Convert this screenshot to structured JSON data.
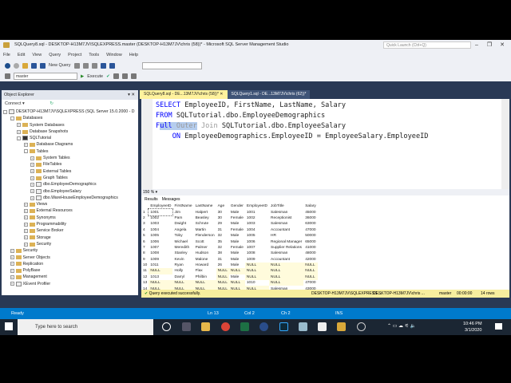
{
  "window": {
    "title": "SQLQuery8.sql - DESKTOP-H13M7JV\\SQLEXPRESS.master (DESKTOP-H13M7JV\\chris (58))* - Microsoft SQL Server Management Studio",
    "quick_launch_placeholder": "Quick Launch (Ctrl+Q)"
  },
  "menu": [
    "File",
    "Edit",
    "View",
    "Query",
    "Project",
    "Tools",
    "Window",
    "Help"
  ],
  "toolbar": {
    "new_query": "New Query",
    "database": "master",
    "execute": "Execute"
  },
  "object_explorer": {
    "title": "Object Explorer",
    "connect": "Connect",
    "nodes": [
      {
        "label": "DESKTOP-H13M7JV\\SQLEXPRESS (SQL Server 15.0.2000 - D",
        "level": 0,
        "type": "server",
        "exp": "-"
      },
      {
        "label": "Databases",
        "level": 1,
        "type": "folder",
        "exp": "-"
      },
      {
        "label": "System Databases",
        "level": 2,
        "type": "folder",
        "exp": "+"
      },
      {
        "label": "Database Snapshots",
        "level": 2,
        "type": "folder",
        "exp": "+"
      },
      {
        "label": "SQLTutorial",
        "level": 2,
        "type": "db",
        "exp": "-"
      },
      {
        "label": "Database Diagrams",
        "level": 3,
        "type": "folder",
        "exp": "+"
      },
      {
        "label": "Tables",
        "level": 3,
        "type": "folder",
        "exp": "-"
      },
      {
        "label": "System Tables",
        "level": 4,
        "type": "folder",
        "exp": "+"
      },
      {
        "label": "FileTables",
        "level": 4,
        "type": "folder",
        "exp": "+"
      },
      {
        "label": "External Tables",
        "level": 4,
        "type": "folder",
        "exp": "+"
      },
      {
        "label": "Graph Tables",
        "level": 4,
        "type": "folder",
        "exp": "+"
      },
      {
        "label": "dbo.EmployeeDemographics",
        "level": 4,
        "type": "table",
        "exp": "+"
      },
      {
        "label": "dbo.EmployeeSalary",
        "level": 4,
        "type": "table",
        "exp": "+"
      },
      {
        "label": "dbo.WareHouseEmployeeDemographics",
        "level": 4,
        "type": "table",
        "exp": "+"
      },
      {
        "label": "Views",
        "level": 3,
        "type": "folder",
        "exp": "+"
      },
      {
        "label": "External Resources",
        "level": 3,
        "type": "folder",
        "exp": "+"
      },
      {
        "label": "Synonyms",
        "level": 3,
        "type": "folder",
        "exp": "+"
      },
      {
        "label": "Programmability",
        "level": 3,
        "type": "folder",
        "exp": "+"
      },
      {
        "label": "Service Broker",
        "level": 3,
        "type": "folder",
        "exp": "+"
      },
      {
        "label": "Storage",
        "level": 3,
        "type": "folder",
        "exp": "+"
      },
      {
        "label": "Security",
        "level": 3,
        "type": "folder",
        "exp": "+"
      },
      {
        "label": "Security",
        "level": 1,
        "type": "folder",
        "exp": "+"
      },
      {
        "label": "Server Objects",
        "level": 1,
        "type": "folder",
        "exp": "+"
      },
      {
        "label": "Replication",
        "level": 1,
        "type": "folder",
        "exp": "+"
      },
      {
        "label": "PolyBase",
        "level": 1,
        "type": "folder",
        "exp": "+"
      },
      {
        "label": "Management",
        "level": 1,
        "type": "folder",
        "exp": "+"
      },
      {
        "label": "XEvent Profiler",
        "level": 1,
        "type": "xevent",
        "exp": "+"
      }
    ]
  },
  "tabs": [
    {
      "label": "SQLQuery8.sql - DE...13M7JV\\chris (58))*",
      "active": true
    },
    {
      "label": "SQLQuery1.sql - DE...13M7JV\\chris (62))*",
      "active": false
    }
  ],
  "editor": {
    "lines": [
      [
        {
          "t": "SELECT",
          "c": "kw"
        },
        {
          "t": " EmployeeID, FirstName, LastName, Salary"
        }
      ],
      [
        {
          "t": "FROM",
          "c": "kw"
        },
        {
          "t": " SQLTutorial.dbo.EmployeeDemographics"
        }
      ],
      [
        {
          "t": "F",
          "c": "kw"
        },
        {
          "t": "ull",
          "c": "kw sel"
        },
        {
          "t": " Outer",
          "c": "gr sel"
        },
        {
          "t": " Join",
          "c": "gr"
        },
        {
          "t": " SQLTutorial.dbo.EmployeeSalary"
        }
      ],
      [
        {
          "t": "    ON",
          "c": "kw"
        },
        {
          "t": " EmployeeDemographics.EmployeeID = EmployeeSalary.EmployeeID"
        }
      ]
    ]
  },
  "zoom": "150 %",
  "results": {
    "tab_results": "Results",
    "tab_messages": "Messages",
    "columns": [
      "EmployeeID",
      "FirstName",
      "LastName",
      "Age",
      "Gender",
      "EmployeeID",
      "JobTitle",
      "Salary"
    ],
    "rows": [
      [
        "1001",
        "Jim",
        "Halpert",
        "30",
        "Male",
        "1001",
        "Salesman",
        "45000"
      ],
      [
        "1002",
        "Pam",
        "Beasley",
        "30",
        "Female",
        "1002",
        "Receptionist",
        "36000"
      ],
      [
        "1003",
        "Dwight",
        "Schrute",
        "29",
        "Male",
        "1003",
        "Salesman",
        "63000"
      ],
      [
        "1004",
        "Angela",
        "Martin",
        "31",
        "Female",
        "1004",
        "Accountant",
        "47000"
      ],
      [
        "1005",
        "Toby",
        "Flenderson",
        "32",
        "Male",
        "1005",
        "HR",
        "50000"
      ],
      [
        "1006",
        "Michael",
        "Scott",
        "35",
        "Male",
        "1006",
        "Regional Manager",
        "65000"
      ],
      [
        "1007",
        "Meredith",
        "Palmer",
        "32",
        "Female",
        "1007",
        "Supplier Relations",
        "41000"
      ],
      [
        "1008",
        "Stanley",
        "Hudson",
        "38",
        "Male",
        "1008",
        "Salesman",
        "48000"
      ],
      [
        "1009",
        "Kevin",
        "Malone",
        "31",
        "Male",
        "1009",
        "Accountant",
        "42000"
      ],
      [
        "1011",
        "Ryan",
        "Howard",
        "26",
        "Male",
        "NULL",
        "NULL",
        "NULL"
      ],
      [
        "NULL",
        "Holly",
        "Flax",
        "NULL",
        "NULL",
        "NULL",
        "NULL",
        "NULL"
      ],
      [
        "1013",
        "Darryl",
        "Philbin",
        "NULL",
        "Male",
        "NULL",
        "NULL",
        "NULL"
      ],
      [
        "NULL",
        "NULL",
        "NULL",
        "NULL",
        "NULL",
        "1010",
        "NULL",
        "47000"
      ],
      [
        "NULL",
        "NULL",
        "NULL",
        "NULL",
        "NULL",
        "NULL",
        "Salesman",
        "43000"
      ]
    ]
  },
  "query_status": {
    "message": "Query executed successfully.",
    "server": "DESKTOP-H13M7JV\\SQLEXPRESS ...",
    "user": "DESKTOP-H13M7JV\\chris ...",
    "database": "master",
    "time": "00:00:00",
    "rows": "14 rows"
  },
  "statusbar": {
    "ready": "Ready",
    "ln": "Ln 13",
    "col": "Col 2",
    "ch": "Ch 2",
    "mode": "INS"
  },
  "taskbar": {
    "search_placeholder": "Type here to search",
    "time": "10:46 PM",
    "date": "3/1/2020"
  },
  "colors": {
    "accent": "#007acc",
    "chrome": "#293955",
    "null_cell": "#fffbdc",
    "status_yellow": "#f7ee9e"
  }
}
